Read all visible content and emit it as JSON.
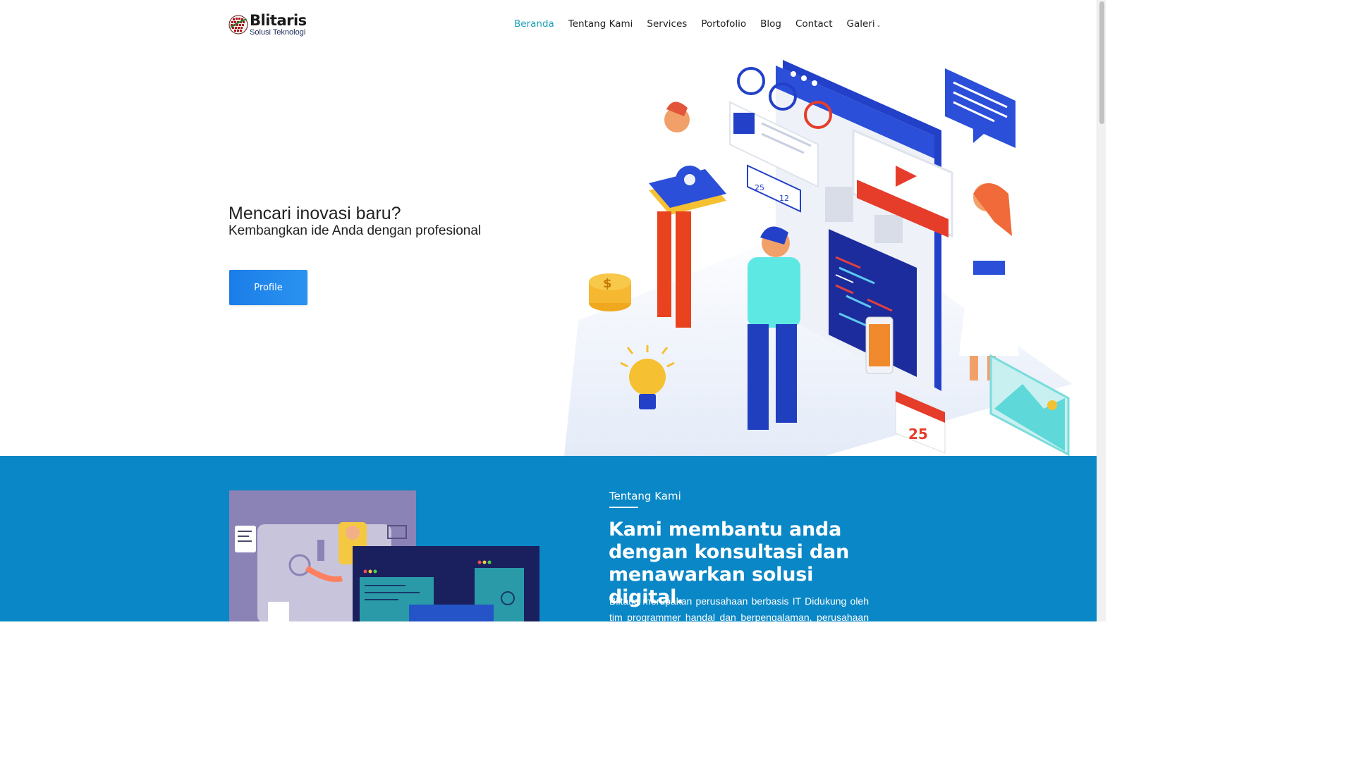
{
  "header": {
    "logo": {
      "brand": "Blitaris",
      "tagline": "Solusi Teknologi"
    },
    "nav": [
      {
        "label": "Beranda",
        "active": true
      },
      {
        "label": "Tentang Kami",
        "active": false
      },
      {
        "label": "Services",
        "active": false
      },
      {
        "label": "Portofolio",
        "active": false
      },
      {
        "label": "Blog",
        "active": false
      },
      {
        "label": "Contact",
        "active": false
      },
      {
        "label": "Galeri",
        "active": false,
        "dropdown": true
      }
    ],
    "dropdown_icon": "chevron-down-icon"
  },
  "hero": {
    "title": "Mencari inovasi baru?",
    "subtitle": "Kembangkan ide Anda dengan profesional",
    "button_label": "Profile",
    "illustration": {
      "calendar_number": "25",
      "like_count": "25",
      "comment_count": "12",
      "coin_symbol": "$"
    }
  },
  "about": {
    "kicker": "Tentang Kami",
    "heading": "Kami membantu anda dengan konsultasi dan menawarkan solusi digital.",
    "text": "Blitaris merupakan perusahaan berbasis IT Didukung oleh tim programmer handal dan berpengalaman, perusahaan kami"
  },
  "colors": {
    "accent": "#1ba3b8",
    "button": "#1b7de8",
    "about_bg": "#0a87c6"
  }
}
